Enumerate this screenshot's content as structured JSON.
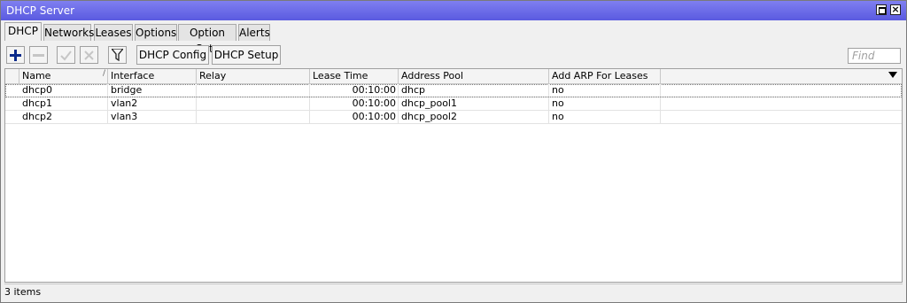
{
  "window": {
    "title": "DHCP Server"
  },
  "tabs": [
    {
      "label": "DHCP",
      "active": true
    },
    {
      "label": "Networks"
    },
    {
      "label": "Leases"
    },
    {
      "label": "Options"
    },
    {
      "label": "Option Sets"
    },
    {
      "label": "Alerts"
    }
  ],
  "toolbar": {
    "add_icon": "plus-icon",
    "remove_icon": "minus-icon",
    "enable_icon": "check-icon",
    "disable_icon": "x-icon",
    "filter_icon": "filter-icon",
    "dhcp_config_label": "DHCP Config",
    "dhcp_setup_label": "DHCP Setup",
    "find_placeholder": "Find"
  },
  "table": {
    "columns": [
      "Name",
      "Interface",
      "Relay",
      "Lease Time",
      "Address Pool",
      "Add ARP For Leases"
    ],
    "rows": [
      {
        "name": "dhcp0",
        "interface": "bridge",
        "relay": "",
        "lease_time": "00:10:00",
        "address_pool": "dhcp",
        "add_arp": "no"
      },
      {
        "name": "dhcp1",
        "interface": "vlan2",
        "relay": "",
        "lease_time": "00:10:00",
        "address_pool": "dhcp_pool1",
        "add_arp": "no"
      },
      {
        "name": "dhcp2",
        "interface": "vlan3",
        "relay": "",
        "lease_time": "00:10:00",
        "address_pool": "dhcp_pool2",
        "add_arp": "no"
      }
    ]
  },
  "status": {
    "text": "3 items"
  },
  "colors": {
    "titlebar": "#5a5ae0",
    "add_icon": "#0a2a8a"
  }
}
